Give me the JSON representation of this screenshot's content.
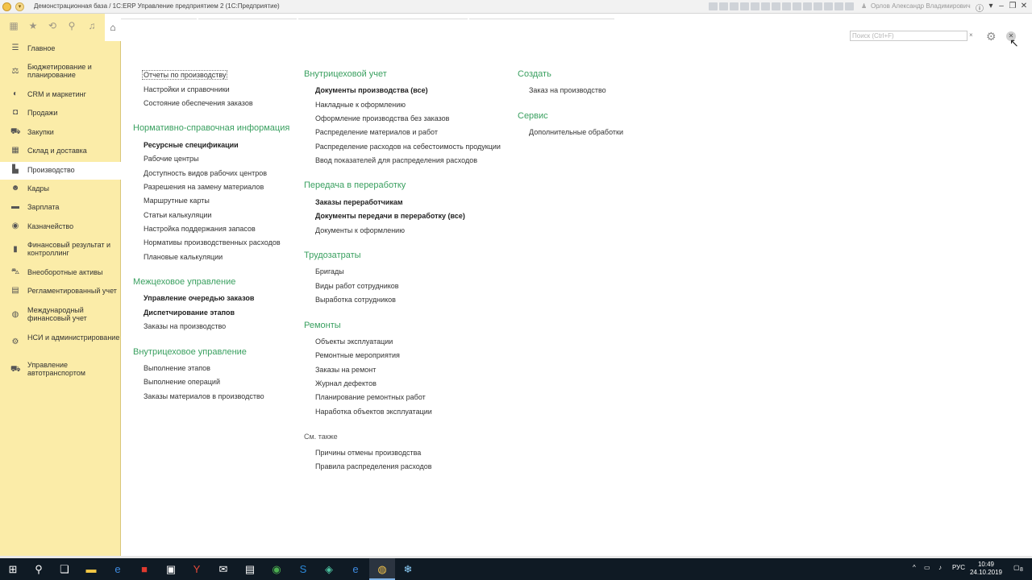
{
  "window": {
    "title": "Демонстрационная база / 1С:ERP Управление предприятием 2  (1С:Предприятие)",
    "user": "Орлов Александр Владимирович"
  },
  "sidebar": {
    "items": [
      {
        "label": "Главное",
        "icon": "menu-icon"
      },
      {
        "label": "Бюджетирование и планирование",
        "icon": "budget-icon"
      },
      {
        "label": "CRM и маркетинг",
        "icon": "crm-icon"
      },
      {
        "label": "Продажи",
        "icon": "sales-icon"
      },
      {
        "label": "Закупки",
        "icon": "purchases-icon"
      },
      {
        "label": "Склад и доставка",
        "icon": "warehouse-icon"
      },
      {
        "label": "Производство",
        "icon": "production-icon"
      },
      {
        "label": "Кадры",
        "icon": "hr-icon"
      },
      {
        "label": "Зарплата",
        "icon": "salary-icon"
      },
      {
        "label": "Казначейство",
        "icon": "treasury-icon"
      },
      {
        "label": "Финансовый результат и контроллинг",
        "icon": "finance-icon"
      },
      {
        "label": "Внеоборотные активы",
        "icon": "assets-icon"
      },
      {
        "label": "Регламентированный учет",
        "icon": "accounting-icon"
      },
      {
        "label": "Международный финансовый учет",
        "icon": "international-icon"
      },
      {
        "label": "НСИ и администрирование",
        "icon": "settings-icon"
      },
      {
        "label": "Управление автотранспортом",
        "icon": "transport-icon"
      }
    ]
  },
  "search": {
    "placeholder": "Поиск (Ctrl+F)",
    "clear": "×"
  },
  "col1": {
    "top_links": [
      "Отчеты по производству",
      "Настройки и справочники",
      "Состояние обеспечения заказов"
    ],
    "nsi": {
      "title": "Нормативно-справочная информация",
      "links": [
        "Ресурсные спецификации",
        "Рабочие центры",
        "Доступность видов рабочих центров",
        "Разрешения на замену материалов",
        "Маршрутные карты",
        "Статьи калькуляции",
        "Настройка поддержания запасов",
        "Нормативы производственных расходов",
        "Плановые калькуляции"
      ]
    },
    "mezh": {
      "title": "Межцеховое управление",
      "links": [
        "Управление очередью заказов",
        "Диспетчирование этапов",
        "Заказы на производство"
      ]
    },
    "vnutr": {
      "title": "Внутрицеховое управление",
      "links": [
        "Выполнение этапов",
        "Выполнение операций",
        "Заказы материалов в производство"
      ]
    }
  },
  "col2": {
    "uchet": {
      "title": "Внутрицеховой учет",
      "links": [
        "Документы производства (все)",
        "Накладные к оформлению",
        "Оформление производства без заказов",
        "Распределение материалов и работ",
        "Распределение расходов на себестоимость продукции",
        "Ввод показателей для распределения расходов"
      ]
    },
    "pererab": {
      "title": "Передача в переработку",
      "links": [
        "Заказы переработчикам",
        "Документы передачи в переработку (все)",
        "Документы к оформлению"
      ]
    },
    "trud": {
      "title": "Трудозатраты",
      "links": [
        "Бригады",
        "Виды работ сотрудников",
        "Выработка сотрудников"
      ]
    },
    "remont": {
      "title": "Ремонты",
      "links": [
        "Объекты эксплуатации",
        "Ремонтные мероприятия",
        "Заказы на ремонт",
        "Журнал дефектов",
        "Планирование ремонтных работ",
        "Наработка объектов эксплуатации"
      ]
    },
    "see_also": {
      "title": "См. также",
      "links": [
        "Причины отмены производства",
        "Правила распределения расходов"
      ]
    }
  },
  "col3": {
    "create": {
      "title": "Создать",
      "links": [
        "Заказ на производство"
      ]
    },
    "service": {
      "title": "Сервис",
      "links": [
        "Дополнительные обработки"
      ]
    }
  },
  "taskbar": {
    "lang": "РУС",
    "time": "10:49",
    "date": "24.10.2019",
    "notif": "8"
  }
}
